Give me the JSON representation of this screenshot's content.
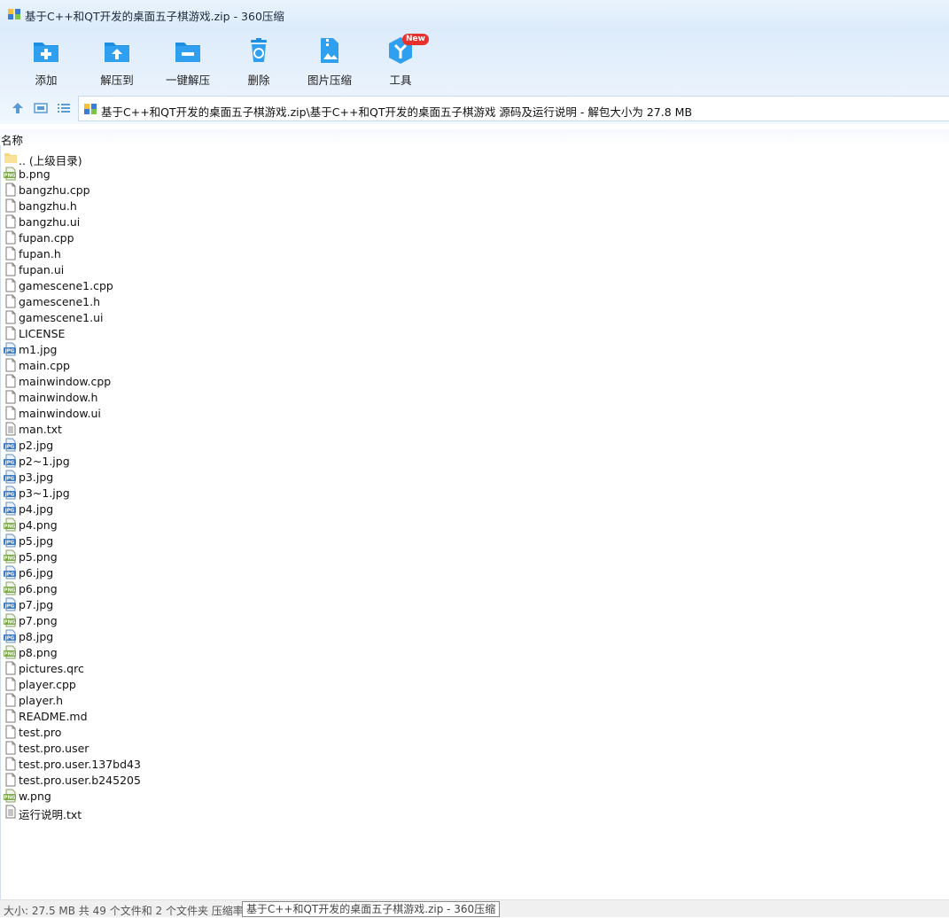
{
  "window": {
    "title": "基于C++和QT开发的桌面五子棋游戏.zip - 360压缩"
  },
  "toolbar": [
    {
      "label": "添加",
      "icon": "add-icon"
    },
    {
      "label": "解压到",
      "icon": "extract-to-icon"
    },
    {
      "label": "一键解压",
      "icon": "one-click-extract-icon"
    },
    {
      "label": "删除",
      "icon": "delete-icon"
    },
    {
      "label": "图片压缩",
      "icon": "image-compress-icon"
    },
    {
      "label": "工具",
      "icon": "tools-icon",
      "badge": "New"
    }
  ],
  "address": {
    "path": "基于C++和QT开发的桌面五子棋游戏.zip\\基于C++和QT开发的桌面五子棋游戏 源码及运行说明 - 解包大小为 27.8 MB"
  },
  "list": {
    "column": "名称",
    "items": [
      {
        "name": ".. (上级目录)",
        "type": "folder"
      },
      {
        "name": "b.png",
        "type": "png"
      },
      {
        "name": "bangzhu.cpp",
        "type": "file"
      },
      {
        "name": "bangzhu.h",
        "type": "file"
      },
      {
        "name": "bangzhu.ui",
        "type": "file"
      },
      {
        "name": "fupan.cpp",
        "type": "file"
      },
      {
        "name": "fupan.h",
        "type": "file"
      },
      {
        "name": "fupan.ui",
        "type": "file"
      },
      {
        "name": "gamescene1.cpp",
        "type": "file"
      },
      {
        "name": "gamescene1.h",
        "type": "file"
      },
      {
        "name": "gamescene1.ui",
        "type": "file"
      },
      {
        "name": "LICENSE",
        "type": "file"
      },
      {
        "name": "m1.jpg",
        "type": "jpg"
      },
      {
        "name": "main.cpp",
        "type": "file"
      },
      {
        "name": "mainwindow.cpp",
        "type": "file"
      },
      {
        "name": "mainwindow.h",
        "type": "file"
      },
      {
        "name": "mainwindow.ui",
        "type": "file"
      },
      {
        "name": "man.txt",
        "type": "txt"
      },
      {
        "name": "p2.jpg",
        "type": "jpg"
      },
      {
        "name": "p2~1.jpg",
        "type": "jpg"
      },
      {
        "name": "p3.jpg",
        "type": "jpg"
      },
      {
        "name": "p3~1.jpg",
        "type": "jpg"
      },
      {
        "name": "p4.jpg",
        "type": "jpg"
      },
      {
        "name": "p4.png",
        "type": "png"
      },
      {
        "name": "p5.jpg",
        "type": "jpg"
      },
      {
        "name": "p5.png",
        "type": "png"
      },
      {
        "name": "p6.jpg",
        "type": "jpg"
      },
      {
        "name": "p6.png",
        "type": "png"
      },
      {
        "name": "p7.jpg",
        "type": "jpg"
      },
      {
        "name": "p7.png",
        "type": "png"
      },
      {
        "name": "p8.jpg",
        "type": "jpg"
      },
      {
        "name": "p8.png",
        "type": "png"
      },
      {
        "name": "pictures.qrc",
        "type": "file"
      },
      {
        "name": "player.cpp",
        "type": "file"
      },
      {
        "name": "player.h",
        "type": "file"
      },
      {
        "name": "README.md",
        "type": "file"
      },
      {
        "name": "test.pro",
        "type": "file"
      },
      {
        "name": "test.pro.user",
        "type": "file"
      },
      {
        "name": "test.pro.user.137bd43",
        "type": "file"
      },
      {
        "name": "test.pro.user.b245205",
        "type": "file"
      },
      {
        "name": "w.png",
        "type": "png"
      },
      {
        "name": "运行说明.txt",
        "type": "txt"
      }
    ]
  },
  "status": {
    "text": "大小: 27.5 MB 共 49 个文件和 2 个文件夹 压缩率",
    "tooltip": "基于C++和QT开发的桌面五子棋游戏.zip - 360压缩"
  },
  "colors": {
    "accent": "#1e8fe0",
    "badge": "#e8302c"
  }
}
